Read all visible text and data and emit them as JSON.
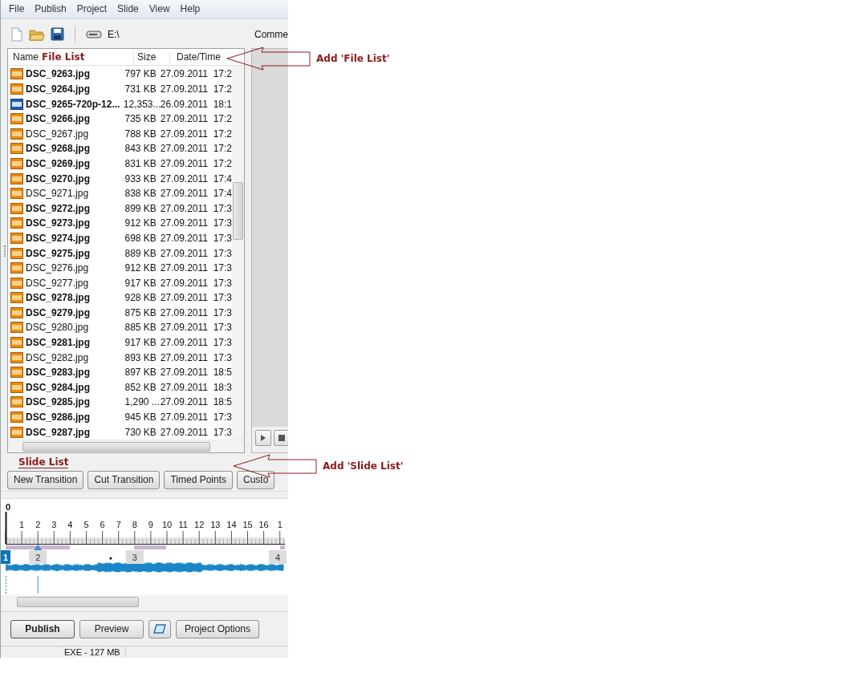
{
  "menu": [
    {
      "label": "File"
    },
    {
      "label": "Publish"
    },
    {
      "label": "Project"
    },
    {
      "label": "Slide"
    },
    {
      "label": "View"
    },
    {
      "label": "Help"
    }
  ],
  "toolbar": {
    "drive_label": "E:\\",
    "side_label": "Comme"
  },
  "file_list": {
    "columns": [
      "Name",
      "Size",
      "Date/Time"
    ],
    "annotation_label": "File List",
    "rows": [
      {
        "kind": "jpg",
        "name": "DSC_9263.jpg",
        "size": "797 KB",
        "date": "27.09.2011  17:2",
        "bold": true
      },
      {
        "kind": "jpg",
        "name": "DSC_9264.jpg",
        "size": "731 KB",
        "date": "27.09.2011  17:2",
        "bold": true
      },
      {
        "kind": "mp4",
        "name": "DSC_9265-720p-12...",
        "size": "12,353...",
        "date": "26.09.2011  18:1",
        "bold": true
      },
      {
        "kind": "jpg",
        "name": "DSC_9266.jpg",
        "size": "735 KB",
        "date": "27.09.2011  17:2",
        "bold": true
      },
      {
        "kind": "jpg",
        "name": "DSC_9267.jpg",
        "size": "788 KB",
        "date": "27.09.2011  17:2",
        "bold": false
      },
      {
        "kind": "jpg",
        "name": "DSC_9268.jpg",
        "size": "843 KB",
        "date": "27.09.2011  17:2",
        "bold": true
      },
      {
        "kind": "jpg",
        "name": "DSC_9269.jpg",
        "size": "831 KB",
        "date": "27.09.2011  17:2",
        "bold": true
      },
      {
        "kind": "jpg",
        "name": "DSC_9270.jpg",
        "size": "933 KB",
        "date": "27.09.2011  17:4",
        "bold": true
      },
      {
        "kind": "jpg",
        "name": "DSC_9271.jpg",
        "size": "838 KB",
        "date": "27.09.2011  17:4",
        "bold": false
      },
      {
        "kind": "jpg",
        "name": "DSC_9272.jpg",
        "size": "899 KB",
        "date": "27.09.2011  17:3",
        "bold": true
      },
      {
        "kind": "jpg",
        "name": "DSC_9273.jpg",
        "size": "912 KB",
        "date": "27.09.2011  17:3",
        "bold": true
      },
      {
        "kind": "jpg",
        "name": "DSC_9274.jpg",
        "size": "698 KB",
        "date": "27.09.2011  17:3",
        "bold": true
      },
      {
        "kind": "jpg",
        "name": "DSC_9275.jpg",
        "size": "889 KB",
        "date": "27.09.2011  17:3",
        "bold": true
      },
      {
        "kind": "jpg",
        "name": "DSC_9276.jpg",
        "size": "912 KB",
        "date": "27.09.2011  17:3",
        "bold": false
      },
      {
        "kind": "jpg",
        "name": "DSC_9277.jpg",
        "size": "917 KB",
        "date": "27.09.2011  17:3",
        "bold": false
      },
      {
        "kind": "jpg",
        "name": "DSC_9278.jpg",
        "size": "928 KB",
        "date": "27.09.2011  17:3",
        "bold": true
      },
      {
        "kind": "jpg",
        "name": "DSC_9279.jpg",
        "size": "875 KB",
        "date": "27.09.2011  17:3",
        "bold": true
      },
      {
        "kind": "jpg",
        "name": "DSC_9280.jpg",
        "size": "885 KB",
        "date": "27.09.2011  17:3",
        "bold": false
      },
      {
        "kind": "jpg",
        "name": "DSC_9281.jpg",
        "size": "917 KB",
        "date": "27.09.2011  17:3",
        "bold": true
      },
      {
        "kind": "jpg",
        "name": "DSC_9282.jpg",
        "size": "893 KB",
        "date": "27.09.2011  17:3",
        "bold": false
      },
      {
        "kind": "jpg",
        "name": "DSC_9283.jpg",
        "size": "897 KB",
        "date": "27.09.2011  18:5",
        "bold": true
      },
      {
        "kind": "jpg",
        "name": "DSC_9284.jpg",
        "size": "852 KB",
        "date": "27.09.2011  18:3",
        "bold": true
      },
      {
        "kind": "jpg",
        "name": "DSC_9285.jpg",
        "size": "1,290 ...",
        "date": "27.09.2011  18:5",
        "bold": true
      },
      {
        "kind": "jpg",
        "name": "DSC_9286.jpg",
        "size": "945 KB",
        "date": "27.09.2011  17:3",
        "bold": true
      },
      {
        "kind": "jpg",
        "name": "DSC_9287.jpg",
        "size": "730 KB",
        "date": "27.09.2011  17:3",
        "bold": true
      }
    ]
  },
  "slide_list": {
    "annotation_label": "Slide List",
    "buttons": [
      {
        "label": "New Transition"
      },
      {
        "label": "Cut Transition"
      },
      {
        "label": "Timed Points"
      },
      {
        "label": "Custo"
      }
    ],
    "ruler_labels": [
      "0",
      "1",
      "2",
      "3",
      "4",
      "5",
      "6",
      "7",
      "8",
      "9",
      "10",
      "11",
      "12",
      "13",
      "14",
      "15",
      "16",
      "1"
    ],
    "slides": [
      {
        "label": "1",
        "selected": true
      },
      {
        "label": "2",
        "selected": false
      },
      {
        "label": "3",
        "selected": false
      },
      {
        "label": "4",
        "selected": false
      }
    ]
  },
  "bottom_buttons": [
    {
      "kind": "text",
      "label": "Publish",
      "default": true
    },
    {
      "kind": "text",
      "label": "Preview",
      "default": false
    },
    {
      "kind": "icon",
      "default": false
    },
    {
      "kind": "text",
      "label": "Project Options",
      "default": false
    }
  ],
  "status_bar": [
    "EXE - 127 MB"
  ],
  "annotations": [
    {
      "text": "Add 'File List'"
    },
    {
      "text": "Add 'Slide List'"
    }
  ]
}
